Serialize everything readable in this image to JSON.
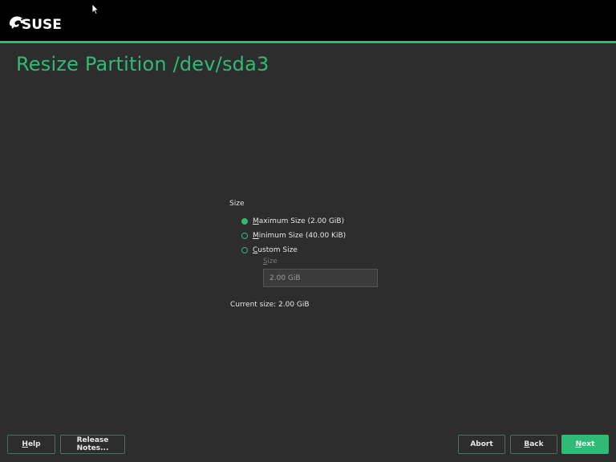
{
  "header": {
    "logo_text": "SUSE",
    "logo_icon": "chameleon-icon",
    "cursor_icon": "mouse-pointer-icon"
  },
  "page": {
    "title": "Resize Partition /dev/sda3"
  },
  "size_group": {
    "label": "Size",
    "options": [
      {
        "label_key": "M",
        "label_rest": "aximum Size (2.00 GiB)",
        "checked": true
      },
      {
        "label_key": "M",
        "label_rest": "inimum Size (40.00 KiB)",
        "checked": false
      },
      {
        "label_key": "C",
        "label_rest": "ustom Size",
        "checked": false
      }
    ],
    "custom_size_label_key": "S",
    "custom_size_label_rest": "ize",
    "custom_size_value": "2.00 GiB"
  },
  "current_size": "Current size: 2.00 GiB",
  "footer": {
    "help_key": "H",
    "help_rest": "elp",
    "release_notes": "Release Notes...",
    "abort": "Abort",
    "back_key": "B",
    "back_rest": "ack",
    "next_key": "N",
    "next_rest": "ext"
  },
  "colors": {
    "accent": "#30ba78",
    "background": "#2d2d2d",
    "header": "#000000"
  }
}
